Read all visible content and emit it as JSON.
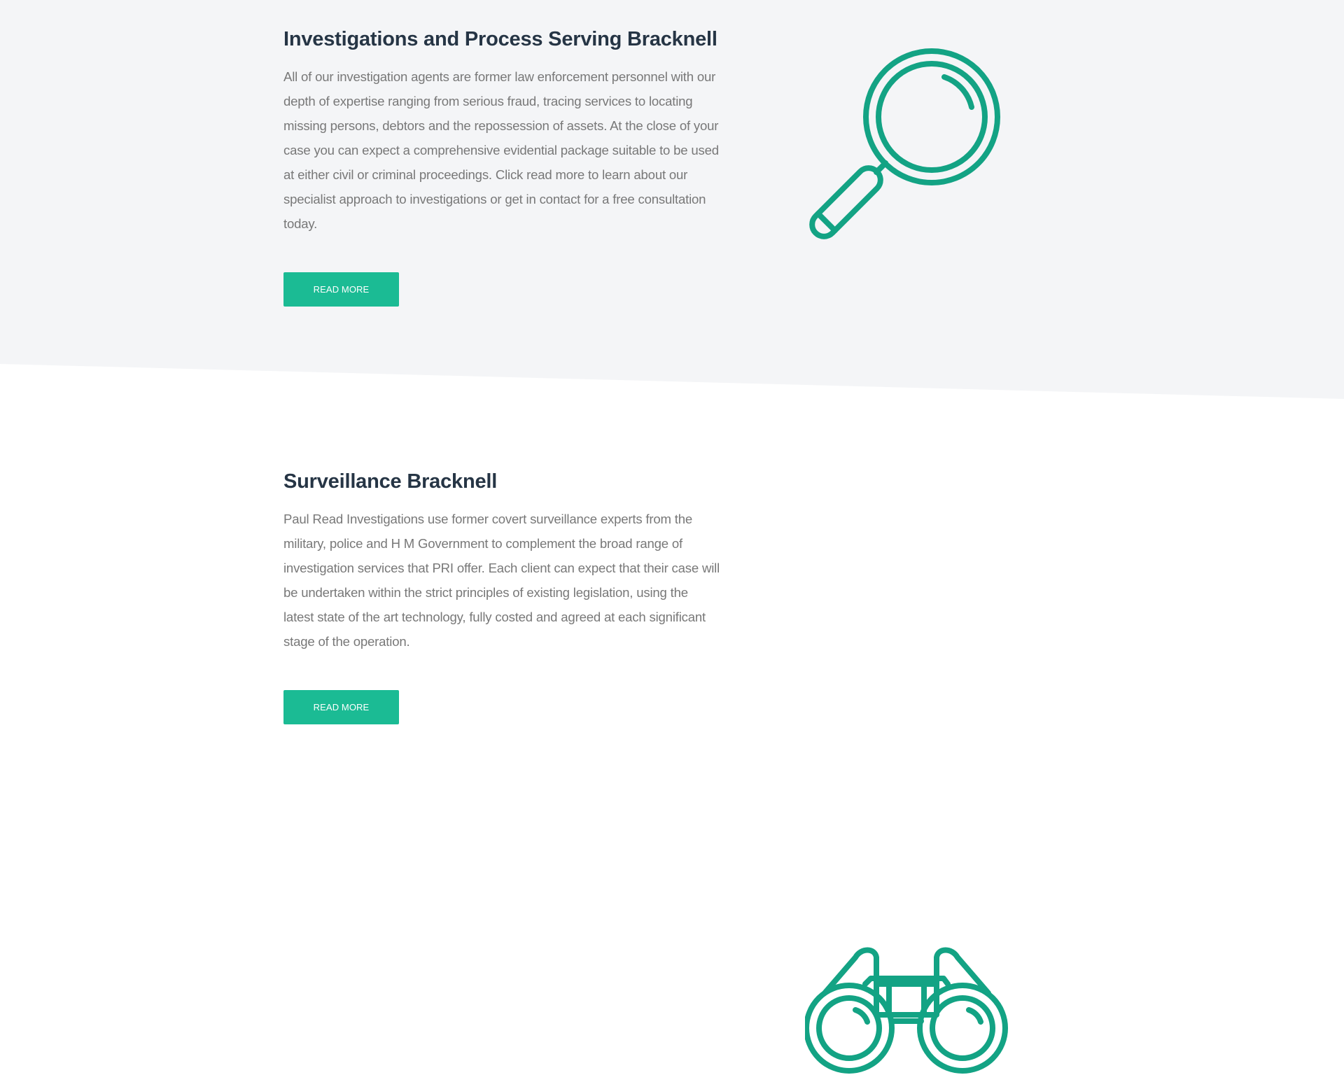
{
  "colors": {
    "section_background": "#f4f5f7",
    "page_background": "#ffffff",
    "heading": "#263545",
    "body_text": "#787878",
    "accent": "#1bbb94",
    "icon_stroke": "#13a384"
  },
  "sections": [
    {
      "title": "Investigations and Process Serving Bracknell",
      "body": "All of our investigation agents are former law enforcement personnel with our depth of expertise ranging from serious fraud, tracing services to locating missing persons, debtors and the repossession of assets. At the close of your case you can expect a comprehensive evidential package suitable to be used at either civil or criminal proceedings. Click read more to learn about our specialist approach to investigations or get in contact for a free consultation today.",
      "button_label": "READ MORE",
      "icon": "magnifying-glass-icon"
    },
    {
      "title": "Surveillance Bracknell",
      "body": "Paul Read Investigations use former covert surveillance experts from the military, police and H M Government to complement the broad range of investigation services that PRI offer. Each client can expect that their case will be undertaken within the strict principles of existing legislation, using the latest state of the art technology, fully costed and agreed at each significant stage of the operation.",
      "button_label": "READ MORE",
      "icon": "binoculars-icon"
    }
  ]
}
